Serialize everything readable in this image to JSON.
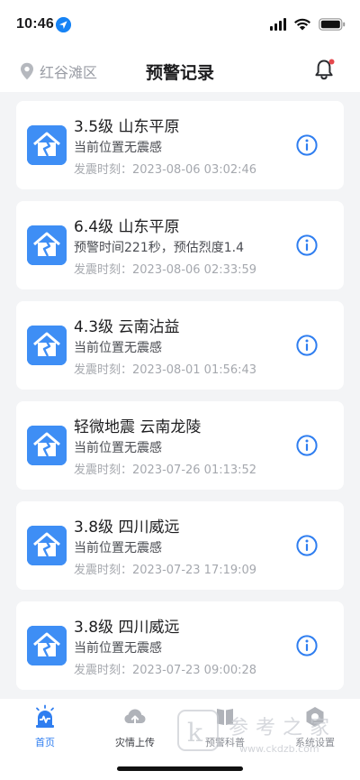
{
  "status_bar": {
    "time": "10:46"
  },
  "header": {
    "location": "红谷滩区",
    "title": "预警记录"
  },
  "records": [
    {
      "title": "3.5级 山东平原",
      "subtitle": "当前位置无震感",
      "time": "发震时刻：2023-08-06 03:02:46"
    },
    {
      "title": "6.4级 山东平原",
      "subtitle": "预警时间221秒，预估烈度1.4",
      "time": "发震时刻：2023-08-06 02:33:59"
    },
    {
      "title": "4.3级 云南沾益",
      "subtitle": "当前位置无震感",
      "time": "发震时刻：2023-08-01 01:56:43"
    },
    {
      "title": "轻微地震 云南龙陵",
      "subtitle": "当前位置无震感",
      "time": "发震时刻：2023-07-26 01:13:52"
    },
    {
      "title": "3.8级 四川威远",
      "subtitle": "当前位置无震感",
      "time": "发震时刻：2023-07-23 17:19:09"
    },
    {
      "title": "3.8级 四川威远",
      "subtitle": "当前位置无震感",
      "time": "发震时刻：2023-07-23 09:00:28"
    }
  ],
  "tabs": [
    {
      "label": "首页",
      "icon": "alarm-icon",
      "active": true
    },
    {
      "label": "灾情上传",
      "icon": "cloud-upload-icon",
      "active": false
    },
    {
      "label": "预警科普",
      "icon": "book-icon",
      "active": false
    },
    {
      "label": "系统设置",
      "icon": "settings-icon",
      "active": false
    }
  ],
  "watermark": {
    "text": "参考之家",
    "url_text": "www.ckdzb.com"
  },
  "colors": {
    "accent": "#2f7ef0",
    "icon_bg": "#3e8ef5",
    "notification_dot": "#e5484d"
  }
}
